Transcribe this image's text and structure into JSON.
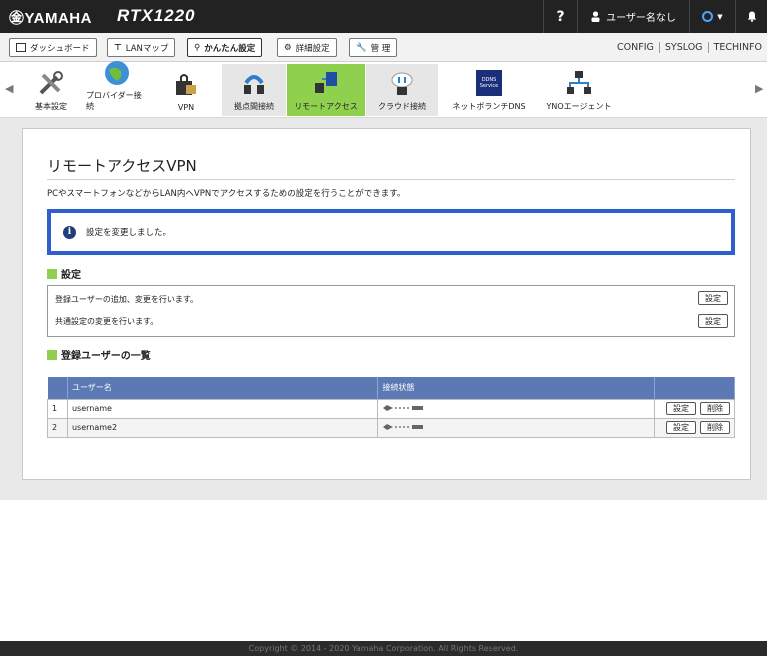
{
  "header": {
    "brand": "㊎YAMAHA",
    "model": "RTX1220",
    "help": "?",
    "user_label": "ユーザー名なし"
  },
  "tabs": [
    {
      "label": "ダッシュボード"
    },
    {
      "label": "LANマップ"
    },
    {
      "label": "かんたん設定"
    },
    {
      "label": "詳細設定"
    },
    {
      "label": "管 理"
    }
  ],
  "toplinks": [
    "CONFIG",
    "SYSLOG",
    "TECHINFO"
  ],
  "nav": [
    {
      "label": "基本設定",
      "icon": "tools-icon"
    },
    {
      "label": "プロバイダー接続",
      "icon": "globe-icon"
    },
    {
      "label": "VPN",
      "icon": "lock-icon"
    },
    {
      "label": "拠点間接続",
      "icon": "site-vpn-icon"
    },
    {
      "label": "リモートアクセス",
      "icon": "remote-access-icon"
    },
    {
      "label": "クラウド接続",
      "icon": "cloud-icon"
    },
    {
      "label": "ネットボランチDNS",
      "icon": "ddns-icon"
    },
    {
      "label": "YNOエージェント",
      "icon": "yno-icon"
    }
  ],
  "ddns_icon_text": "DDNS Service",
  "page": {
    "title": "リモートアクセスVPN",
    "description": "PCやスマートフォンなどからLAN内へVPNでアクセスするための設定を行うことができます。",
    "notice": "設定を変更しました。"
  },
  "settings": {
    "heading": "設定",
    "rows": [
      {
        "text": "登録ユーザーの追加、変更を行います。",
        "button": "設定"
      },
      {
        "text": "共通設定の変更を行います。",
        "button": "設定"
      }
    ]
  },
  "users": {
    "heading": "登録ユーザーの一覧",
    "columns": [
      "",
      "ユーザー名",
      "接続状態",
      ""
    ],
    "rows": [
      {
        "index": "1",
        "name": "username",
        "edit": "設定",
        "delete": "削除"
      },
      {
        "index": "2",
        "name": "username2",
        "edit": "設定",
        "delete": "削除"
      }
    ]
  },
  "footer": "Copyright © 2014 - 2020 Yamaha Corporation. All Rights Reserved.",
  "colors": {
    "accent_green": "#8fd14f",
    "table_header": "#5b79b5",
    "notice_border": "#2f5fcf"
  }
}
